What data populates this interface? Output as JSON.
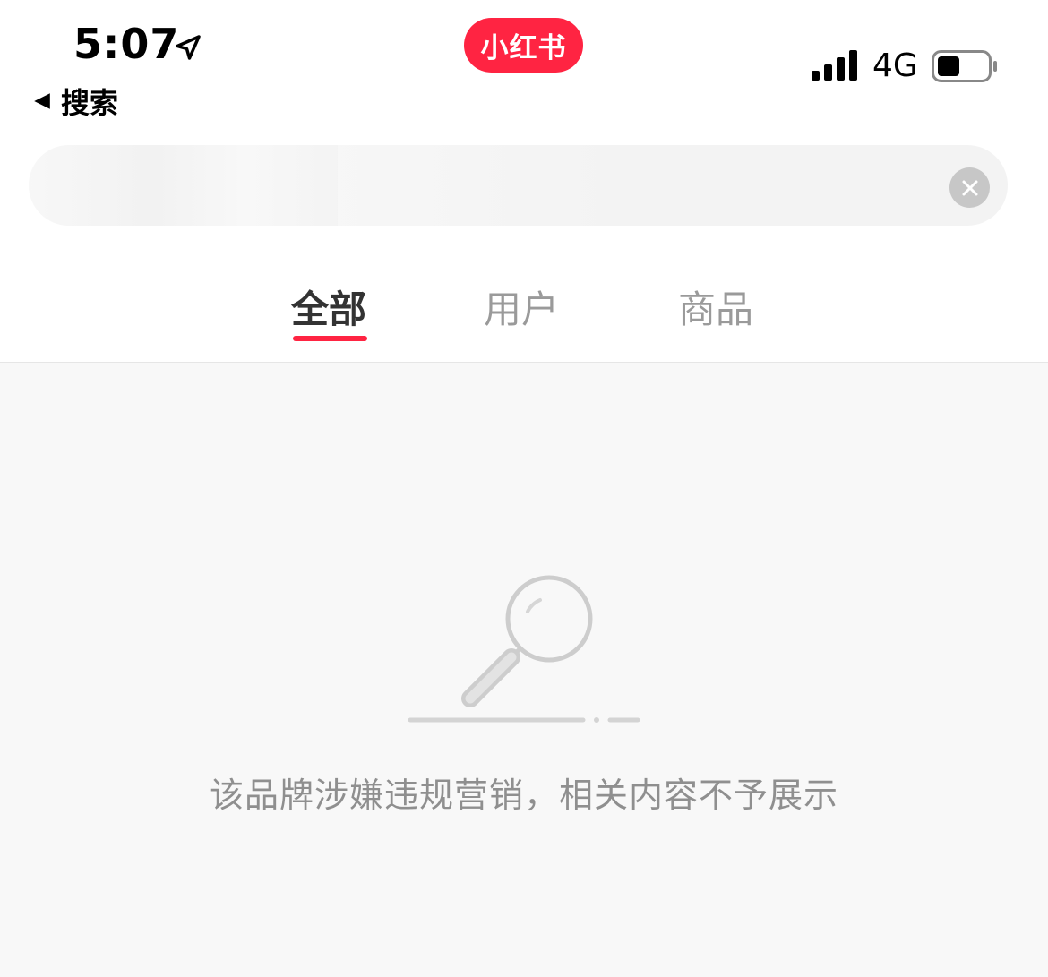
{
  "status_bar": {
    "time": "5:07",
    "network": "4G",
    "icons": {
      "location": "location-arrow-icon",
      "signal": "signal-bars-icon",
      "battery": "battery-icon"
    }
  },
  "navigation": {
    "back_label": "搜索",
    "back_icon": "back-triangle-icon"
  },
  "brand": {
    "name": "小红书",
    "color": "#ff2442"
  },
  "search": {
    "clear_icon": "clear-x-icon"
  },
  "tabs": [
    {
      "label": "全部",
      "active": true
    },
    {
      "label": "用户",
      "active": false
    },
    {
      "label": "商品",
      "active": false
    }
  ],
  "empty_state": {
    "icon": "magnifying-glass-icon",
    "message": "该品牌涉嫌违规营销，相关内容不予展示"
  },
  "colors": {
    "accent": "#ff2442",
    "background": "#f8f8f8"
  }
}
